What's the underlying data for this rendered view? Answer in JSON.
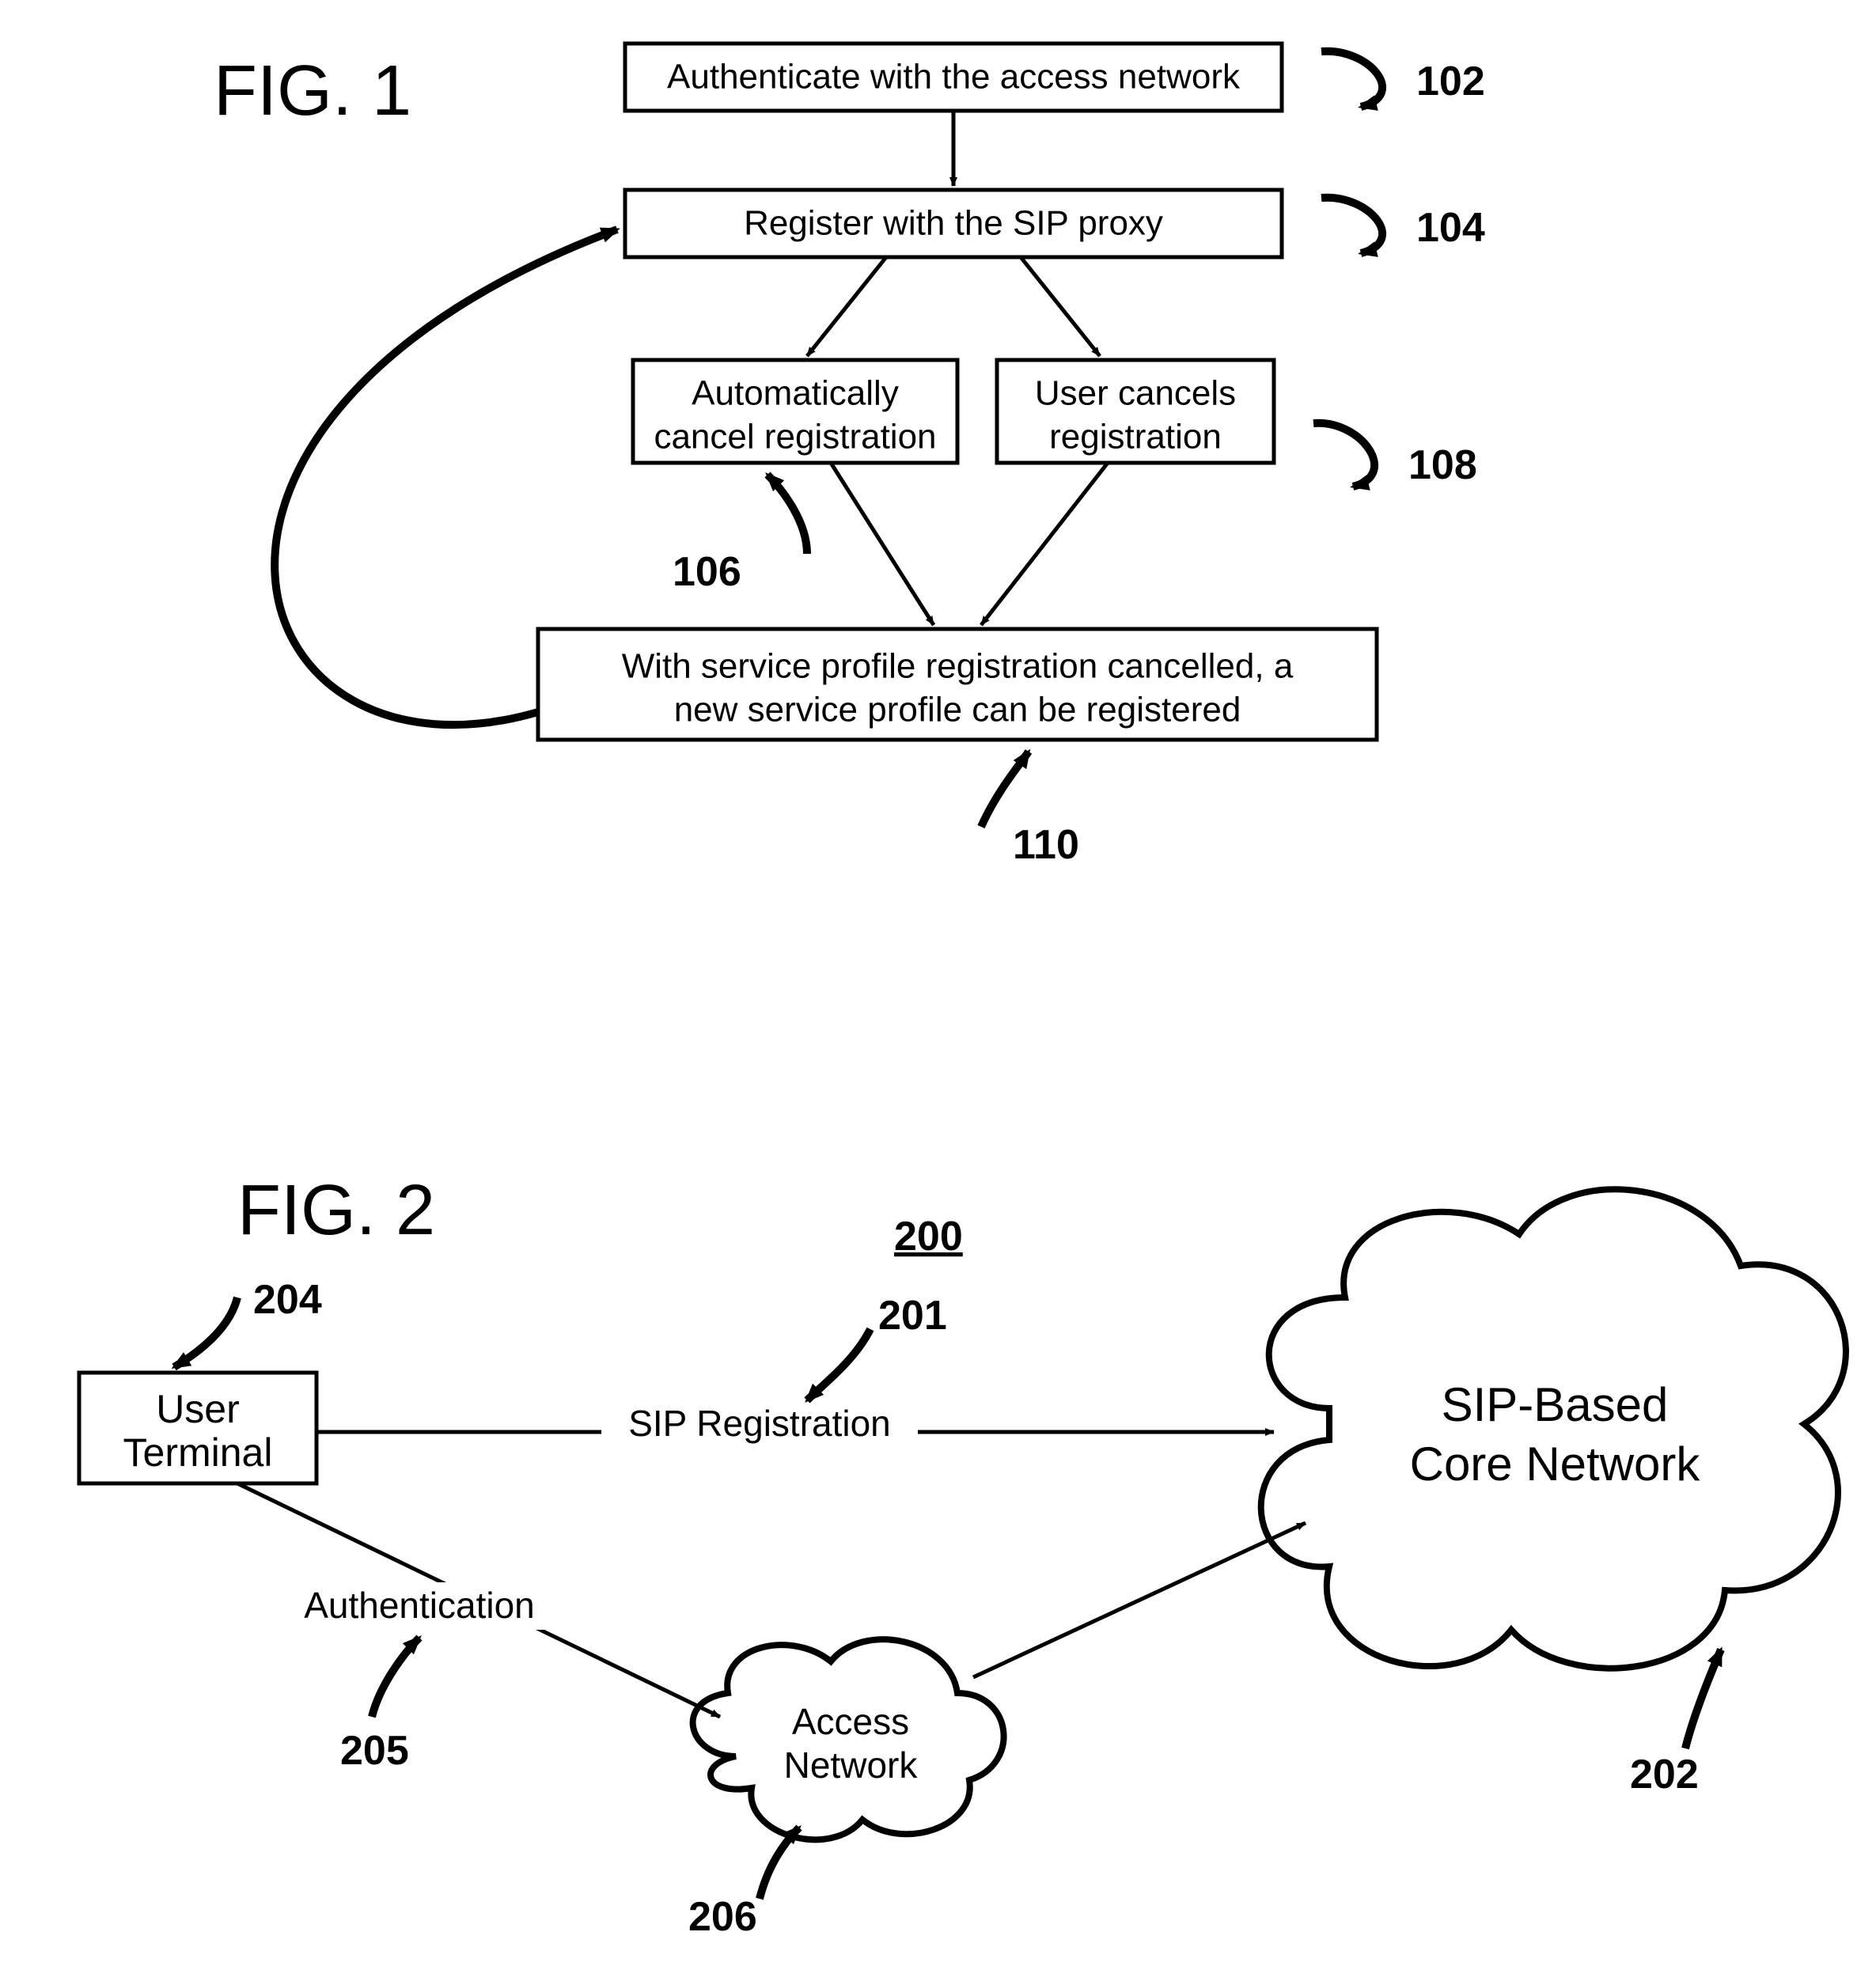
{
  "fig1": {
    "title": "FIG. 1",
    "box102": "Authenticate with the access network",
    "box104": "Register with the SIP proxy",
    "box106_l1": "Automatically",
    "box106_l2": "cancel registration",
    "box108_l1": "User cancels",
    "box108_l2": "registration",
    "box110_l1": "With service profile registration cancelled, a",
    "box110_l2": "new service profile can be registered",
    "lbl102": "102",
    "lbl104": "104",
    "lbl106": "106",
    "lbl108": "108",
    "lbl110": "110"
  },
  "fig2": {
    "title": "FIG. 2",
    "sys": "200",
    "user_l1": "User",
    "user_l2": "Terminal",
    "sip_reg": "SIP Registration",
    "auth": "Authentication",
    "access_l1": "Access",
    "access_l2": "Network",
    "core_l1": "SIP-Based",
    "core_l2": "Core Network",
    "lbl201": "201",
    "lbl202": "202",
    "lbl204": "204",
    "lbl205": "205",
    "lbl206": "206"
  }
}
